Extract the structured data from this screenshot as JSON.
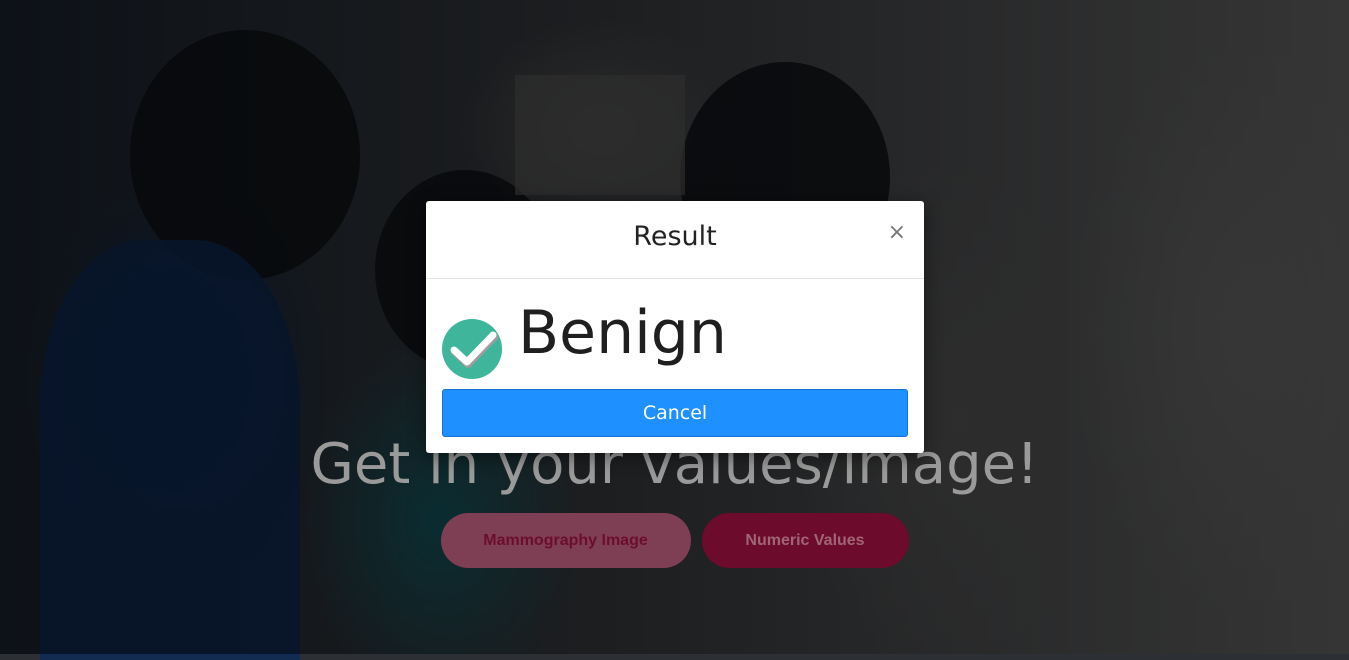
{
  "hero": {
    "heading": "Get in your values/image!",
    "buttons": {
      "image_label": "Mammography Image",
      "numeric_label": "Numeric Values"
    }
  },
  "modal": {
    "title": "Result",
    "close_symbol": "×",
    "result": "Benign",
    "result_icon": "check-circle-icon",
    "cancel_label": "Cancel"
  },
  "colors": {
    "primary_button": "#1e90ff",
    "check_icon": "#3fb59c",
    "pill_accent": "#6c0b2c"
  }
}
